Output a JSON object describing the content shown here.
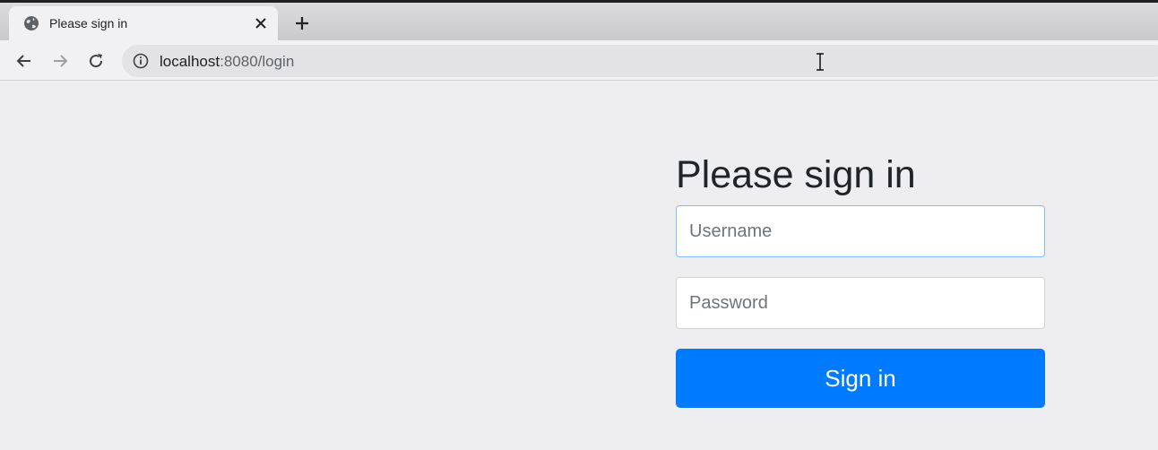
{
  "browser": {
    "tab": {
      "title": "Please sign in",
      "favicon": "globe-icon",
      "close_icon": "close-icon"
    },
    "new_tab_icon": "plus-icon",
    "nav": {
      "back_icon": "arrow-left-icon",
      "forward_icon": "arrow-right-icon",
      "reload_icon": "reload-icon"
    },
    "address": {
      "info_icon": "info-icon",
      "host": "localhost",
      "rest": ":8080/login"
    }
  },
  "login": {
    "heading": "Please sign in",
    "username_placeholder": "Username",
    "password_placeholder": "Password",
    "submit_label": "Sign in"
  },
  "colors": {
    "primary": "#007bff",
    "page_background": "#eeeef0",
    "heading_text": "#212529",
    "input_focus_border": "#80bdff"
  }
}
